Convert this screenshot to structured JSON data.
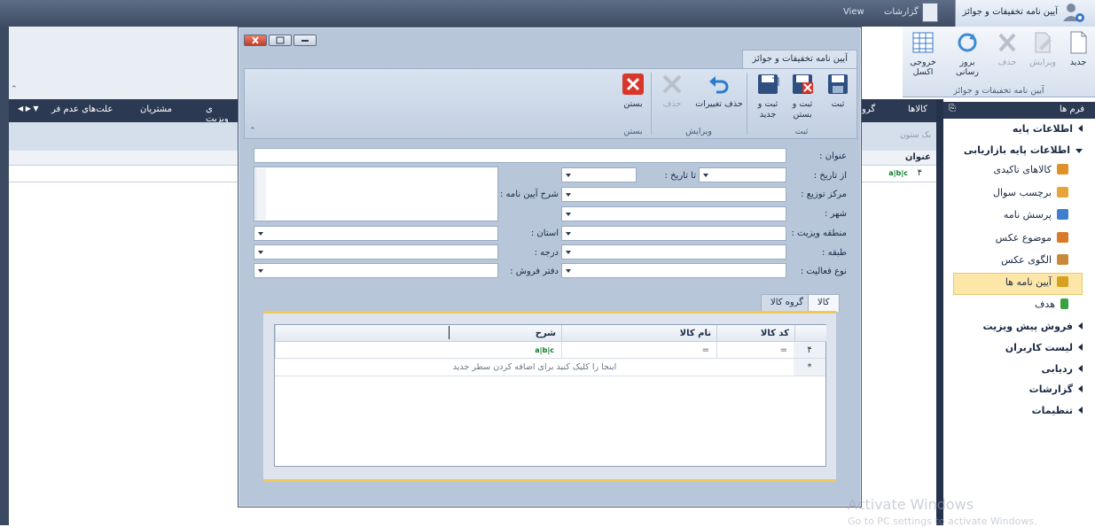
{
  "app": {
    "title": "آیین نامه تخفیفات و جوائز",
    "tabs": [
      {
        "label": "گزارشات"
      },
      {
        "label": "View"
      }
    ],
    "ribbon": {
      "buttons": [
        {
          "label": "جدید",
          "icon": "new-document-icon",
          "enabled": true
        },
        {
          "label": "ویرایش",
          "icon": "edit-icon",
          "enabled": false
        },
        {
          "label": "حذف",
          "icon": "delete-icon",
          "enabled": false
        },
        {
          "label": "بروز رسانی",
          "icon": "refresh-icon",
          "enabled": true
        },
        {
          "label": "خروجی اکسل",
          "icon": "excel-export-icon",
          "enabled": true
        }
      ],
      "group_caption": "آیین نامه تخفیفات و جوائز"
    },
    "left_panel": {
      "columns": [
        "علت‌های عدم فر",
        "مشتریان",
        "ی ویزیت",
        "گرو"
      ],
      "mid_columns": [
        "کالاها"
      ],
      "grid_header": "عنوان",
      "row_indicator": "۴",
      "abc_marker": "a|b|c",
      "sub_hint": "بک ستون"
    }
  },
  "navigation": {
    "title": "فرم ها",
    "items": [
      {
        "label": "اطلاعات پایه",
        "type": "group",
        "open": false
      },
      {
        "label": "اطلاعات پایه بازاریابی",
        "type": "group",
        "open": true
      },
      {
        "label": "کالاهای تاکیدی",
        "type": "item",
        "icon_color": "#e0902a"
      },
      {
        "label": "برچسب سوال",
        "type": "item",
        "icon_color": "#e8a33a"
      },
      {
        "label": "پرسش نامه",
        "type": "item",
        "icon_color": "#3f7fd0"
      },
      {
        "label": "موضوع عکس",
        "type": "item",
        "icon_color": "#d87a2a"
      },
      {
        "label": "الگوی عکس",
        "type": "item",
        "icon_color": "#c88a3a"
      },
      {
        "label": "آیین نامه ها",
        "type": "item",
        "icon_color": "#d6a020",
        "selected": true
      },
      {
        "label": "هدف",
        "type": "item",
        "icon_color": "#3aa040"
      },
      {
        "label": "فروش پیش ویزیت",
        "type": "group",
        "open": false
      },
      {
        "label": "لیست کاربران",
        "type": "group",
        "open": false
      },
      {
        "label": "ردیابی",
        "type": "group",
        "open": false
      },
      {
        "label": "گزارشات",
        "type": "group",
        "open": false
      },
      {
        "label": "تنظیمات",
        "type": "group",
        "open": false
      }
    ]
  },
  "dialog": {
    "tab_label": "آیین نامه تخفیفات و جوائز",
    "ribbon": {
      "groups": [
        {
          "caption": "ثبت",
          "buttons": [
            {
              "label": "ثبت",
              "icon": "save-icon",
              "enabled": true
            },
            {
              "label": "ثبت و بستن",
              "icon": "save-close-icon",
              "enabled": true
            },
            {
              "label": "ثبت و جدید",
              "icon": "save-new-icon",
              "enabled": true
            }
          ]
        },
        {
          "caption": "ویرایش",
          "buttons": [
            {
              "label": "حذف تغییرات",
              "icon": "undo-icon",
              "enabled": true
            },
            {
              "label": "حذف",
              "icon": "delete-icon",
              "enabled": false
            }
          ]
        },
        {
          "caption": "بستن",
          "buttons": [
            {
              "label": "بستن",
              "icon": "close-red-icon",
              "enabled": true
            }
          ]
        }
      ]
    },
    "form": {
      "title_label": "عنوان :",
      "from_date_label": "از تاریخ :",
      "to_date_label": "تا تاریخ :",
      "description_label": "شرح آیین نامه :",
      "distribution_center_label": "مرکز توزیع :",
      "city_label": "شهر :",
      "visit_region_label": "منطقه ویزیت :",
      "province_label": "استان :",
      "class_label": "طبقه :",
      "grade_label": "درجه :",
      "activity_type_label": "نوع فعالیت :",
      "sales_office_label": "دفتر فروش :"
    },
    "grid": {
      "tabs": [
        {
          "label": "کالا",
          "active": true
        },
        {
          "label": "گروه کالا",
          "active": false
        }
      ],
      "columns": [
        "کد کالا",
        "نام کالا",
        "شرح"
      ],
      "row_indicator": "۴",
      "equals_marker": "=",
      "abc_marker": "a|b|c",
      "new_row_marker": "*",
      "new_row_hint": "اینجا را کلیک کنید برای اضافه کردن سطر جدید"
    }
  },
  "watermark": {
    "line1": "Activate Windows",
    "line2": "Go to PC settings to activate Windows."
  }
}
